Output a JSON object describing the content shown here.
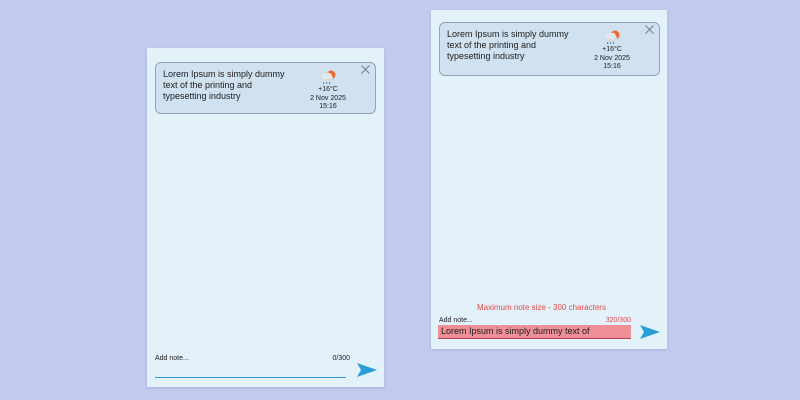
{
  "screens": {
    "empty": {
      "note": {
        "text": "Lorem Ipsum is simply dummy text of the printing and typesetting industry",
        "weather_icon": "cloud-sun-rain-icon",
        "temperature": "+16°C",
        "date": "2 Nov 2025",
        "time": "15:16"
      },
      "input": {
        "placeholder": "Add note...",
        "counter": "0/300",
        "value": ""
      }
    },
    "overflow": {
      "note": {
        "text": "Lorem Ipsum is simply dummy text of the printing and typesetting industry",
        "weather_icon": "cloud-sun-rain-icon",
        "temperature": "+16°C",
        "date": "2 Nov 2025",
        "time": "15:16"
      },
      "warning": "Maximum note size - 300 characters",
      "input": {
        "placeholder": "Add note...",
        "counter": "320/300",
        "value": "Lorem Ipsum is simply dummy text of"
      }
    }
  },
  "colors": {
    "background": "#c2cbee",
    "screen": "#e3f1fa",
    "card": "#d0e2f0",
    "accent": "#2a9ed6",
    "error": "#e04a4a",
    "error_fill": "#f09096"
  }
}
